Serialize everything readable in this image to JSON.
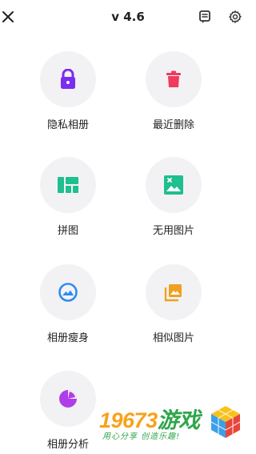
{
  "header": {
    "title": "v 4.6",
    "close_icon": "close-icon",
    "feedback_icon": "feedback-icon",
    "settings_icon": "gear-icon"
  },
  "features": [
    {
      "label": "隐私相册",
      "icon": "lock-icon",
      "color": "#7b2cf0"
    },
    {
      "label": "最近删除",
      "icon": "trash-icon",
      "color": "#ef3a5d"
    },
    {
      "label": "拼图",
      "icon": "collage-icon",
      "color": "#1fbf8f"
    },
    {
      "label": "无用图片",
      "icon": "broken-image-icon",
      "color": "#1fbf8f"
    },
    {
      "label": "相册瘦身",
      "icon": "slim-icon",
      "color": "#2f8bf0"
    },
    {
      "label": "相似图片",
      "icon": "similar-photos-icon",
      "color": "#f0a020"
    },
    {
      "label": "相册分析",
      "icon": "pie-chart-icon",
      "color": "#b03ee8"
    }
  ],
  "watermark": {
    "title_number": "19673",
    "title_text": "游戏",
    "subtitle": "用心分享 创造乐趣!",
    "number_color": "#f7a21b",
    "text_color": "#2fa64a"
  }
}
